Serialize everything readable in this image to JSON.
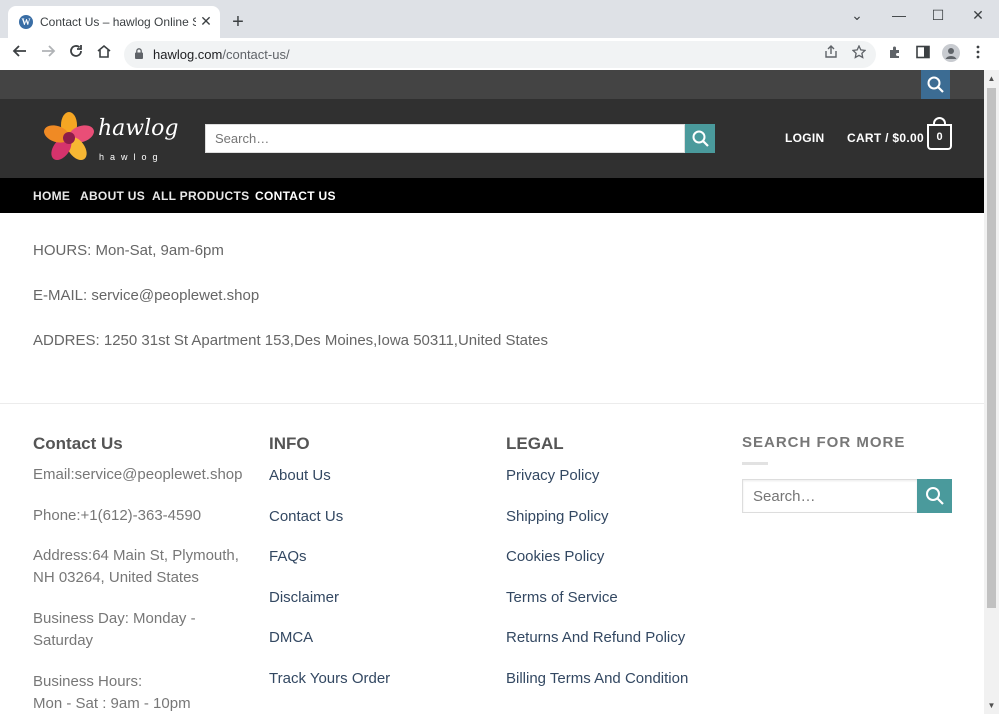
{
  "browser": {
    "tab_title": "Contact Us – hawlog Online Shop",
    "tab_favicon": "wordpress-icon",
    "url_host": "hawlog.com",
    "url_path": "/contact-us/",
    "new_tab_label": "+",
    "close_tab_label": "✕",
    "win_dropdown": "⌄",
    "win_minimize": "—",
    "win_maximize": "☐",
    "win_close": "✕"
  },
  "site": {
    "logo_text": "hawlog",
    "logo_sub": "hawlog",
    "search_placeholder": "Search…",
    "login_label": "LOGIN",
    "cart_label": "CART / $0.00",
    "cart_count": "0",
    "nav": [
      {
        "label": "HOME"
      },
      {
        "label": "ABOUT US"
      },
      {
        "label": "ALL PRODUCTS"
      },
      {
        "label": "CONTACT US"
      }
    ]
  },
  "content": {
    "hours": "HOURS: Mon-Sat, 9am-6pm",
    "email": "E-MAIL: service@peoplewet.shop",
    "address": "ADDRES: 1250 31st St Apartment 153,Des Moines,Iowa 50311,United States"
  },
  "footer": {
    "contact": {
      "title": "Contact Us",
      "email": "Email:service@peoplewet.shop",
      "phone": "Phone:+1(612)-363-4590",
      "address_1": "Address:64 Main St, Plymouth,",
      "address_2": "NH 03264, United States",
      "business_day_1": "Business Day: Monday -",
      "business_day_2": "Saturday",
      "business_hours_1": "Business Hours:",
      "business_hours_2": "Mon - Sat : 9am - 10pm"
    },
    "info": {
      "title": "INFO",
      "links": [
        "About Us",
        "Contact Us",
        "FAQs",
        "Disclaimer",
        "DMCA",
        "Track Yours Order"
      ]
    },
    "legal": {
      "title": "LEGAL",
      "links": [
        "Privacy Policy",
        "Shipping Policy",
        "Cookies Policy",
        "Terms of Service",
        "Returns And Refund Policy",
        "Billing Terms And Condition"
      ]
    },
    "search": {
      "title": "SEARCH FOR MORE",
      "placeholder": "Search…"
    }
  },
  "colors": {
    "topbar": "#444444",
    "header": "#303030",
    "nav": "#000000",
    "accent": "#4a9a9c",
    "topbar_search": "#3c6c93",
    "link": "#334862"
  }
}
